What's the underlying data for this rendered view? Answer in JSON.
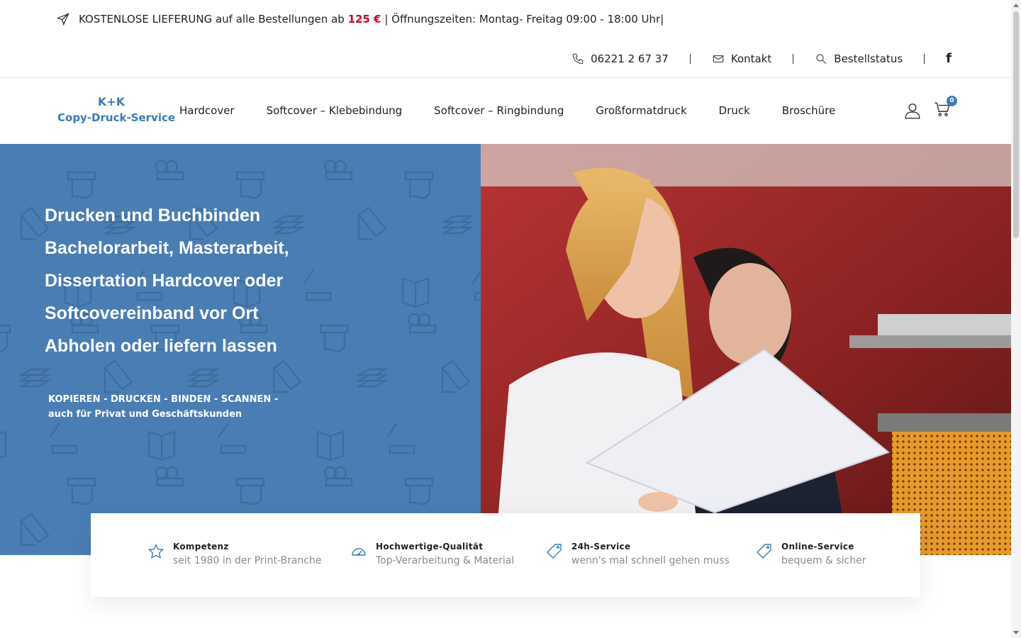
{
  "topbar": {
    "announce_before": "KOSTENLOSE LIEFERUNG auf alle Bestellungen ab",
    "announce_price": "125 €",
    "announce_after": "| Öffnungszeiten: Montag- Freitag 09:00 - 18:00 Uhr|",
    "send_icon": "paper-plane-icon",
    "phone": "06221 2 67 37",
    "contact_label": "Kontakt",
    "order_status_label": "Bestellstatus",
    "facebook_glyph": "f",
    "price_color": "#d0021b"
  },
  "logo": {
    "line1": "K+K",
    "line2": "Copy-Druck-Service",
    "color": "#3e7ab4"
  },
  "nav": {
    "items": [
      "Hardcover",
      "Softcover – Klebebindung",
      "Softcover – Ringbindung",
      "Großformatdruck",
      "Druck",
      "Broschüre"
    ],
    "cart_count": "0"
  },
  "hero": {
    "title_lines": [
      "Drucken und Buchbinden",
      "Bachelorarbeit, Masterarbeit,",
      "Dissertation Hardcover oder",
      "Softcovereinband vor Ort",
      "Abholen oder liefern lassen"
    ],
    "sub_line1": "KOPIEREN - DRUCKEN - BINDEN - SCANNEN -",
    "sub_line2": "auch für Privat und Geschäftskunden",
    "bg_color": "#4a7db3"
  },
  "features": [
    {
      "icon": "star-icon",
      "title": "Kompetenz",
      "text": "seit 1980 in der Print-Branche"
    },
    {
      "icon": "speedometer-icon",
      "title": "Hochwertige-Qualität",
      "text": "Top-Verarbeitung & Material"
    },
    {
      "icon": "tag-icon",
      "title": "24h-Service",
      "text": "wenn's mal schnell gehen muss"
    },
    {
      "icon": "tag-icon",
      "title": "Online-Service",
      "text": "bequem & sicher"
    }
  ]
}
